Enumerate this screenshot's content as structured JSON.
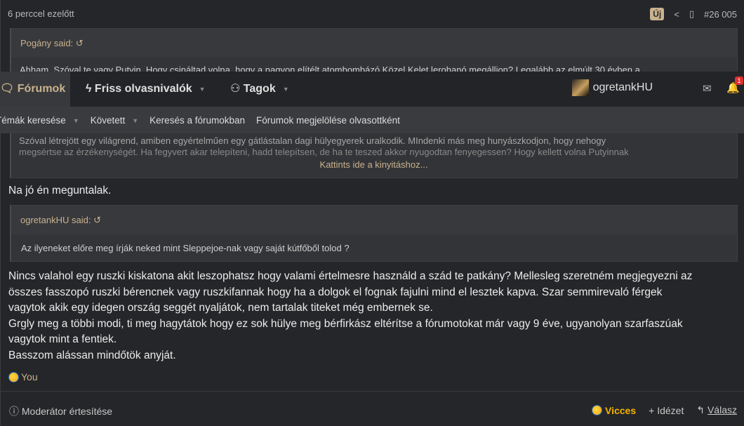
{
  "post": {
    "time": "6 perccel ezelőtt",
    "new_badge": "Új",
    "post_number": "#26 005",
    "quote1": {
      "author": "Pogány said:",
      "line1": "Ahham. Szóval te vagy Putyin. Hogy csináltad volna, hogy a nagyon elítélt atombombázó Közel Kelet lerohanó megálljon? Legalább az elmúlt 30 évben a",
      "line2": "Szóval létrejött egy világrend, amiben egyértelműen egy gátlástalan dagi hülyegyerek uralkodik. MIndenki más meg hunyászkodjon, hogy nehogy",
      "line3": "megsértse az érzékenységét. Ha fegyvert akar telepíteni, hadd telepítsen, de ha te teszed akkor nyugodtan fenyegessen? Hogy kellett volna Putyinnak",
      "expand": "Kattints ide a kinyitáshoz..."
    },
    "reply1": "Na jó én meguntalak.",
    "quote2": {
      "author": "ogretankHU said:",
      "body": "Az ilyeneket előre meg írják neked mint Sleppejoe-nak vagy saját kútfőből tolod ?"
    },
    "body_lines": [
      "Nincs valahol egy ruszki kiskatona akit leszophatsz hogy valami értelmesre használd a szád te patkány? Mellesleg szeretném megjegyezni az",
      "összes fasszopó ruszki bérencnek vagy ruszkifannak hogy ha a dolgok el fognak fajulni mind el lesztek kapva. Szar semmirevaló férgek",
      "vagytok akik egy idegen ország seggét nyaljátok, nem tartalak titeket még embernek se.",
      "Grgly meg a többi modi, ti meg hagytátok hogy ez sok hülye meg bérfirkász eltérítse a fórumotokat már vagy 9 éve, ugyanolyan szarfaszúak",
      "vagytok mint a fentiek.",
      "Basszom alássan mindőtök anyját."
    ],
    "reaction": "You",
    "report": "Moderátor értesítése",
    "actions": {
      "funny": "Vicces",
      "quote": "Idézet",
      "reply": "Válasz"
    }
  },
  "nav": {
    "items": [
      {
        "label": "Fórumok",
        "icon": "chat-icon"
      },
      {
        "label": "Friss olvasnivalók",
        "icon": "bolt-icon"
      },
      {
        "label": "Tagok",
        "icon": "users-icon"
      }
    ],
    "sub": [
      "Témák keresése",
      "Követett",
      "Keresés a fórumokban",
      "Fórumok megjelölése olvasottként"
    ],
    "username": "ogretankHU",
    "notification_count": "1"
  },
  "colors": {
    "accent": "#c9b28e",
    "funny": "#f5b400",
    "badge": "#e03030"
  }
}
